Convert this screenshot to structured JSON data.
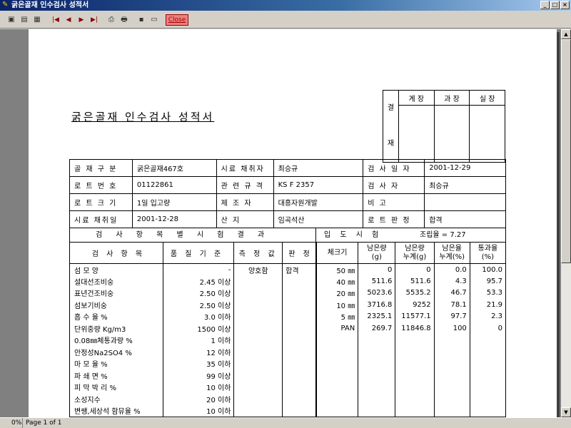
{
  "window": {
    "title": "굵은골재 인수검사 성적서",
    "buttons": [
      "_",
      "□",
      "×"
    ]
  },
  "toolbar": {
    "close_label": "Close",
    "icons": [
      "page-view-icon",
      "two-page-icon",
      "fit-icon",
      "first-page-icon",
      "prev-page-icon",
      "next-page-icon",
      "last-page-icon",
      "print-setup-icon",
      "print-icon",
      "save-icon",
      "open-icon"
    ]
  },
  "status": {
    "zoom": "0%",
    "page": "Page 1 of 1"
  },
  "report": {
    "title": "굵은골재 인수검사 성적서",
    "approval": {
      "side_top": "결",
      "side_bottom": "재",
      "headers": [
        "계 장",
        "과 장",
        "실 장"
      ]
    },
    "info": [
      [
        "골 재 구 분",
        "굵은골재467호",
        "시료 채취자",
        "최승규",
        "검 사 일 자",
        "2001-12-29"
      ],
      [
        "로 트 번 호",
        "01122861",
        "관 련 규 격",
        "KS F 2357",
        "검    사    자",
        "최승규"
      ],
      [
        "로 트 크 기",
        "1일 입고량",
        "제    조    자",
        "대흥자원개발",
        "비          고",
        ""
      ],
      [
        "시료 채취일",
        "2001-12-28",
        "산          지",
        "임곡석산",
        "로 트 판 정",
        "합격"
      ]
    ],
    "section_left": "검 사 항 목 별 시 험 결 과",
    "section_right": "입 도 시 험",
    "fineness_label": "조립율 = 7.27",
    "test_headers": [
      "검 사 항 목",
      "품 질 기 준",
      "측 정 값",
      "판 정"
    ],
    "tests": [
      [
        "섬 모 양",
        "-",
        "양호함",
        "합격"
      ],
      [
        "설대선조비숭",
        "2.45 이상",
        "",
        ""
      ],
      [
        "표년건조비숭",
        "2.50 이상",
        "",
        ""
      ],
      [
        "섬보기비숭",
        "2.50 이상",
        "",
        ""
      ],
      [
        "흡 수 율 %",
        "3.0 이하",
        "",
        ""
      ],
      [
        "단위중량 Kg/m3",
        "1500 이상",
        "",
        ""
      ],
      [
        "0.08㎜체통과량 %",
        "1 이하",
        "",
        ""
      ],
      [
        "안정성Na2SO4 %",
        "12 이하",
        "",
        ""
      ],
      [
        "마 모 율 %",
        "35 이하",
        "",
        ""
      ],
      [
        "파 쇄 면 %",
        "99 이상",
        "",
        ""
      ],
      [
        "피 막 박 리 %",
        "10 이하",
        "",
        ""
      ],
      [
        "소성지수",
        "20 이하",
        "",
        ""
      ],
      [
        "변쌩,세상석 함뮤율 %",
        "10 이하",
        "",
        ""
      ]
    ],
    "grading_headers": [
      "체크기",
      "남은량\n(g)",
      "남은량\n누계(g)",
      "남은율\n누계(%)",
      "통과율\n(%)"
    ],
    "grading": [
      [
        "50 ㎜",
        "0",
        "0",
        "0.0",
        "100.0"
      ],
      [
        "40 ㎜",
        "511.6",
        "511.6",
        "4.3",
        "95.7"
      ],
      [
        "20 ㎜",
        "5023.6",
        "5535.2",
        "46.7",
        "53.3"
      ],
      [
        "10 ㎜",
        "3716.8",
        "9252",
        "78.1",
        "21.9"
      ],
      [
        "5 ㎜",
        "2325.1",
        "11577.1",
        "97.7",
        "2.3"
      ],
      [
        "PAN",
        "269.7",
        "11846.8",
        "100",
        "0"
      ]
    ]
  }
}
